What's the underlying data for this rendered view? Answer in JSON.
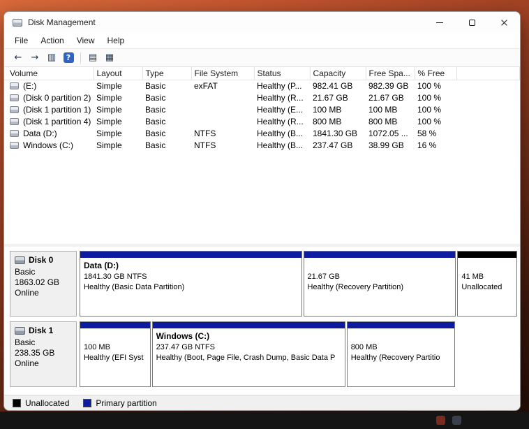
{
  "window": {
    "title": "Disk Management"
  },
  "menu": {
    "items": [
      "File",
      "Action",
      "View",
      "Help"
    ]
  },
  "toolbar": {
    "icons": [
      {
        "name": "back",
        "glyph": "←"
      },
      {
        "name": "forward",
        "glyph": "→"
      },
      {
        "name": "console-tree",
        "glyph": "▥"
      },
      {
        "name": "help",
        "glyph": "?"
      },
      {
        "name": "show-hide-pane",
        "glyph": "▤"
      },
      {
        "name": "properties",
        "glyph": "▦"
      }
    ]
  },
  "table": {
    "columns": [
      "Volume",
      "Layout",
      "Type",
      "File System",
      "Status",
      "Capacity",
      "Free Spa...",
      "% Free"
    ],
    "rows": [
      {
        "volume": "(E:)",
        "layout": "Simple",
        "type": "Basic",
        "fs": "exFAT",
        "status": "Healthy (P...",
        "capacity": "982.41 GB",
        "free": "982.39 GB",
        "pct": "100 %"
      },
      {
        "volume": "(Disk 0 partition 2)",
        "layout": "Simple",
        "type": "Basic",
        "fs": "",
        "status": "Healthy (R...",
        "capacity": "21.67 GB",
        "free": "21.67 GB",
        "pct": "100 %"
      },
      {
        "volume": "(Disk 1 partition 1)",
        "layout": "Simple",
        "type": "Basic",
        "fs": "",
        "status": "Healthy (E...",
        "capacity": "100 MB",
        "free": "100 MB",
        "pct": "100 %"
      },
      {
        "volume": "(Disk 1 partition 4)",
        "layout": "Simple",
        "type": "Basic",
        "fs": "",
        "status": "Healthy (R...",
        "capacity": "800 MB",
        "free": "800 MB",
        "pct": "100 %"
      },
      {
        "volume": "Data (D:)",
        "layout": "Simple",
        "type": "Basic",
        "fs": "NTFS",
        "status": "Healthy (B...",
        "capacity": "1841.30 GB",
        "free": "1072.05 ...",
        "pct": "58 %"
      },
      {
        "volume": "Windows (C:)",
        "layout": "Simple",
        "type": "Basic",
        "fs": "NTFS",
        "status": "Healthy (B...",
        "capacity": "237.47 GB",
        "free": "38.99 GB",
        "pct": "16 %"
      }
    ]
  },
  "disks": [
    {
      "name": "Disk 0",
      "type": "Basic",
      "size": "1863.02 GB",
      "status": "Online",
      "partitions": [
        {
          "title": "Data  (D:)",
          "line2": "1841.30 GB NTFS",
          "line3": "Healthy (Basic Data Partition)"
        },
        {
          "title": "",
          "line2": "21.67 GB",
          "line3": "Healthy (Recovery Partition)"
        },
        {
          "title": "",
          "line2": "41 MB",
          "line3": "Unallocated"
        }
      ]
    },
    {
      "name": "Disk 1",
      "type": "Basic",
      "size": "238.35 GB",
      "status": "Online",
      "partitions": [
        {
          "title": "",
          "line2": "100 MB",
          "line3": "Healthy (EFI Syst"
        },
        {
          "title": "Windows  (C:)",
          "line2": "237.47 GB NTFS",
          "line3": "Healthy (Boot, Page File, Crash Dump, Basic Data P"
        },
        {
          "title": "",
          "line2": "800 MB",
          "line3": "Healthy (Recovery Partitio"
        }
      ]
    }
  ],
  "legend": {
    "items": [
      {
        "label": "Unallocated"
      },
      {
        "label": "Primary partition"
      }
    ]
  },
  "colors": {
    "primary_partition": "#0c1ca0",
    "unallocated": "#000000"
  }
}
